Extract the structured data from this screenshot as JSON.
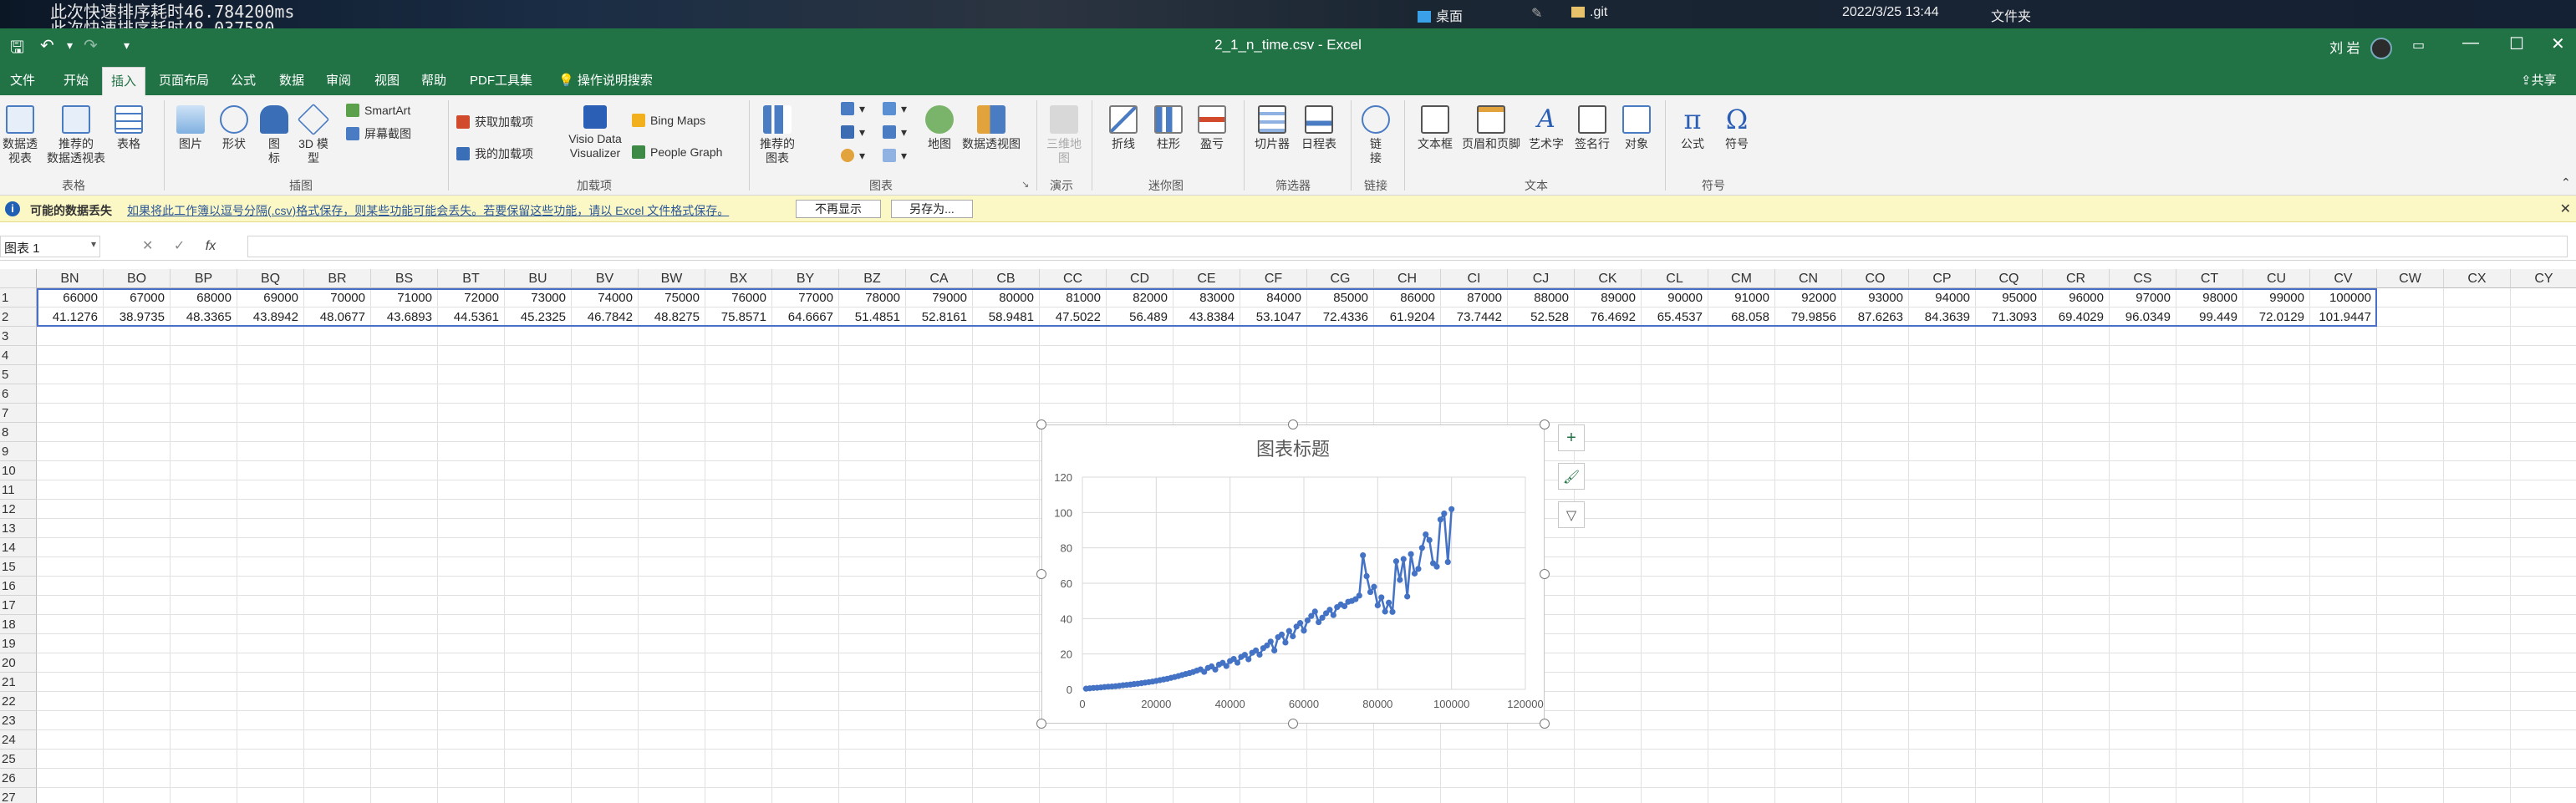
{
  "taskbar": {
    "terminal_line1": "此次快速排序耗时46.784200ms",
    "terminal_line2": "此次快速排序耗时48.037580",
    "desktop_label": "桌面",
    "git_label": ".git",
    "datetime": "2022/3/25 13:44",
    "folder_type": "文件夹"
  },
  "titlebar": {
    "document_title": "2_1_n_time.csv  -  Excel",
    "user_name": "刘 岩",
    "share_label": "共享"
  },
  "tabs": [
    "文件",
    "开始",
    "插入",
    "页面布局",
    "公式",
    "数据",
    "审阅",
    "视图",
    "帮助",
    "PDF工具集"
  ],
  "active_tab": "插入",
  "tell_me": "操作说明搜索",
  "ribbon": {
    "pivot_table": "数据透\n视表",
    "recommended_pivot": "推荐的\n数据透视表",
    "table": "表格",
    "picture": "图片",
    "shapes": "形状",
    "icons": "图\n标",
    "models_3d": "3D 模\n型",
    "smartart": "SmartArt",
    "screenshot": "屏幕截图",
    "get_addins": "获取加载项",
    "my_addins": "我的加载项",
    "visio": "Visio Data\nVisualizer",
    "bing_maps": "Bing Maps",
    "people_graph": "People Graph",
    "recommended_charts": "推荐的\n图表",
    "maps": "地图",
    "pivot_chart": "数据透视图",
    "map_3d": "三维地\n图",
    "line": "折线",
    "column": "柱形",
    "win_loss": "盈亏",
    "slicer": "切片器",
    "timeline": "日程表",
    "link": "链\n接",
    "textbox": "文本框",
    "header_footer": "页眉和页脚",
    "wordart": "艺术字",
    "signature": "签名行",
    "object": "对象",
    "equation": "公式",
    "symbol": "符号",
    "group_tables": "表格",
    "group_illustrations": "插图",
    "group_addins": "加载项",
    "group_charts": "图表",
    "group_tours": "演示",
    "group_sparklines": "迷你图",
    "group_filters": "筛选器",
    "group_links": "链接",
    "group_text": "文本",
    "group_symbols": "符号"
  },
  "message_bar": {
    "title": "可能的数据丢失",
    "text": "如果将此工作簿以逗号分隔(.csv)格式保存，则某些功能可能会丢失。若要保留这些功能，请以 Excel 文件格式保存。",
    "dont_show": "不再显示",
    "save_as": "另存为..."
  },
  "formula_bar": {
    "name_box": "图表 1",
    "fx": "fx",
    "formula": ""
  },
  "sheet": {
    "columns": [
      "BN",
      "BO",
      "BP",
      "BQ",
      "BR",
      "BS",
      "BT",
      "BU",
      "BV",
      "BW",
      "BX",
      "BY",
      "BZ",
      "CA",
      "CB",
      "CC",
      "CD",
      "CE",
      "CF",
      "CG",
      "CH",
      "CI",
      "CJ",
      "CK",
      "CL",
      "CM",
      "CN",
      "CO",
      "CP",
      "CQ",
      "CR",
      "CS",
      "CT",
      "CU",
      "CV",
      "CW",
      "CX",
      "CY"
    ],
    "row1": [
      "66000",
      "67000",
      "68000",
      "69000",
      "70000",
      "71000",
      "72000",
      "73000",
      "74000",
      "75000",
      "76000",
      "77000",
      "78000",
      "79000",
      "80000",
      "81000",
      "82000",
      "83000",
      "84000",
      "85000",
      "86000",
      "87000",
      "88000",
      "89000",
      "90000",
      "91000",
      "92000",
      "93000",
      "94000",
      "95000",
      "96000",
      "97000",
      "98000",
      "99000",
      "100000",
      "",
      "",
      ""
    ],
    "row2": [
      "41.1276",
      "38.9735",
      "48.3365",
      "43.8942",
      "48.0677",
      "43.6893",
      "44.5361",
      "45.2325",
      "46.7842",
      "48.8275",
      "75.8571",
      "64.6667",
      "51.4851",
      "52.8161",
      "58.9481",
      "47.5022",
      "56.489",
      "43.8384",
      "53.1047",
      "72.4336",
      "61.9204",
      "73.7442",
      "52.528",
      "76.4692",
      "65.4537",
      "68.058",
      "79.9856",
      "87.6263",
      "84.3639",
      "71.3093",
      "69.4029",
      "96.0349",
      "99.449",
      "72.0129",
      "101.9447",
      "",
      "",
      ""
    ],
    "row_numbers": [
      "1",
      "2",
      "3",
      "4",
      "5",
      "6",
      "7",
      "8",
      "9",
      "10",
      "11",
      "12",
      "13",
      "14",
      "15",
      "16",
      "17",
      "18",
      "19",
      "20",
      "21",
      "22",
      "23",
      "24",
      "25",
      "26",
      "27"
    ]
  },
  "chart_data": {
    "type": "scatter",
    "title": "图表标题",
    "xlim": [
      0,
      120000
    ],
    "ylim": [
      0,
      120
    ],
    "x_ticks": [
      "0",
      "20000",
      "40000",
      "60000",
      "80000",
      "100000",
      "120000"
    ],
    "y_ticks": [
      "0",
      "20",
      "40",
      "60",
      "80",
      "100",
      "120"
    ],
    "series_color": "#4472c4",
    "grid": true,
    "x": [
      1000,
      2000,
      3000,
      4000,
      5000,
      6000,
      7000,
      8000,
      9000,
      10000,
      11000,
      12000,
      13000,
      14000,
      15000,
      16000,
      17000,
      18000,
      19000,
      20000,
      21000,
      22000,
      23000,
      24000,
      25000,
      26000,
      27000,
      28000,
      29000,
      30000,
      31000,
      32000,
      33000,
      34000,
      35000,
      36000,
      37000,
      38000,
      39000,
      40000,
      41000,
      42000,
      43000,
      44000,
      45000,
      46000,
      47000,
      48000,
      49000,
      50000,
      51000,
      52000,
      53000,
      54000,
      55000,
      56000,
      57000,
      58000,
      59000,
      60000,
      61000,
      62000,
      63000,
      64000,
      65000,
      66000,
      67000,
      68000,
      69000,
      70000,
      71000,
      72000,
      73000,
      74000,
      75000,
      76000,
      77000,
      78000,
      79000,
      80000,
      81000,
      82000,
      83000,
      84000,
      85000,
      86000,
      87000,
      88000,
      89000,
      90000,
      91000,
      92000,
      93000,
      94000,
      95000,
      96000,
      97000,
      98000,
      99000,
      100000
    ],
    "y": [
      0.4,
      0.6,
      0.8,
      0.9,
      1.1,
      1.3,
      1.5,
      1.6,
      1.8,
      2.0,
      2.3,
      2.5,
      2.7,
      3.0,
      3.2,
      3.5,
      3.8,
      4.1,
      4.4,
      4.8,
      5.2,
      5.6,
      6.0,
      6.5,
      7.0,
      7.5,
      8.1,
      8.7,
      9.2,
      9.8,
      10.6,
      11.3,
      9.9,
      12.1,
      13.0,
      11.2,
      14.0,
      15.0,
      13.2,
      16.0,
      17.2,
      15.1,
      18.3,
      19.5,
      17.0,
      20.7,
      22.0,
      19.6,
      23.3,
      24.8,
      27.0,
      22.0,
      29.5,
      31.0,
      26.5,
      33.0,
      30.0,
      35.5,
      37.5,
      33.2,
      39.0,
      41.5,
      44.0,
      38.0,
      40.5,
      43.0,
      45.0,
      42.0,
      46.5,
      48.0,
      47.0,
      49.5,
      50.0,
      51.0,
      53.0,
      75.8,
      64.0,
      55.0,
      58.0,
      47.5,
      52.0,
      44.0,
      49.0,
      43.8,
      72.4,
      61.9,
      73.7,
      52.5,
      76.5,
      65.5,
      68.1,
      80.0,
      87.6,
      84.4,
      71.3,
      69.4,
      96.0,
      99.4,
      72.0,
      101.9
    ]
  }
}
